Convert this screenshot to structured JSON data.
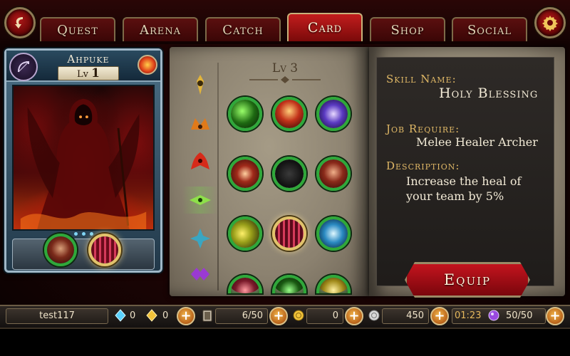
{
  "nav": {
    "back_icon": "back-arrow-icon",
    "settings_icon": "gear-icon",
    "tabs": [
      {
        "label": "Quest"
      },
      {
        "label": "Arena"
      },
      {
        "label": "Catch"
      },
      {
        "label": "Card"
      },
      {
        "label": "Shop"
      },
      {
        "label": "Social"
      }
    ],
    "active_tab": "Card"
  },
  "card": {
    "name": "Ahpuke",
    "level_label": "Lv",
    "level": "1",
    "class_icon": "bow-icon",
    "element_icon": "fire-icon",
    "skills": [
      {
        "icon": "shield-skill-icon",
        "selected": false
      },
      {
        "icon": "holy-blessing-skill-icon",
        "selected": true
      }
    ]
  },
  "skill_book": {
    "level_title": "Lv 3",
    "job_icons": [
      "job-1-icon",
      "job-2-icon",
      "job-3-icon",
      "job-4-icon",
      "job-5-icon",
      "job-6-icon"
    ],
    "active_job_index": 3,
    "skills": [
      {
        "icon": "skill-green-slash-icon"
      },
      {
        "icon": "skill-fire-fist-icon"
      },
      {
        "icon": "skill-arcane-icon"
      },
      {
        "icon": "skill-burst-icon"
      },
      {
        "icon": "skill-shadow-icon"
      },
      {
        "icon": "skill-guard-icon"
      },
      {
        "icon": "skill-moon-icon"
      },
      {
        "icon": "skill-holy-blessing-icon",
        "selected": true
      },
      {
        "icon": "skill-wind-icon"
      },
      {
        "icon": "skill-partial-1-icon"
      },
      {
        "icon": "skill-partial-2-icon"
      },
      {
        "icon": "skill-partial-3-icon"
      }
    ]
  },
  "details": {
    "skill_name_label": "Skill Name:",
    "skill_name": "Holy Blessing",
    "job_require_label": "Job Require:",
    "job_require": "Melee Healer Archer",
    "description_label": "Description:",
    "description": "Increase the heal of your team by 5%",
    "equip_label": "Equip"
  },
  "status_bar": {
    "player_name": "test117",
    "blue_gem_count": "0",
    "gold_gem_count": "0",
    "cards": "6/50",
    "coins": "0",
    "silver": "450",
    "timer": "01:23",
    "energy": "50/50",
    "colors": {
      "accent_red": "#c21d1d",
      "ring_green": "#2fa83a",
      "gold_text": "#e0b866"
    }
  }
}
